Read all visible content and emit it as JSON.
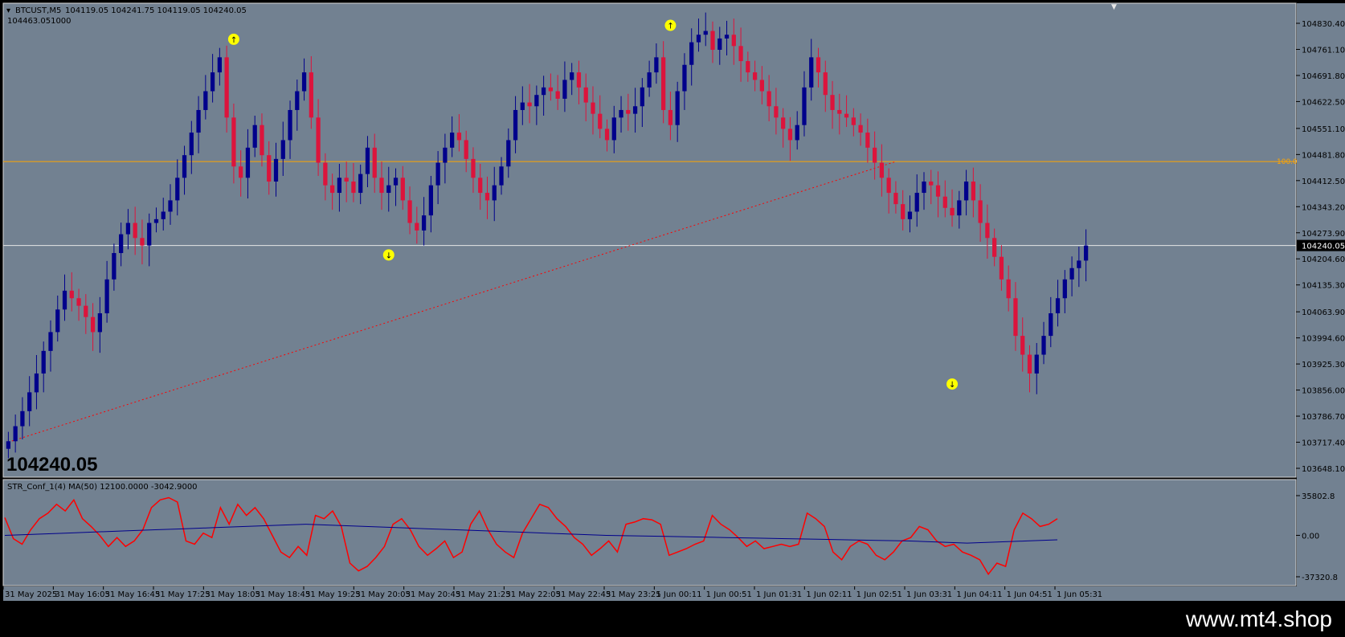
{
  "window": {
    "symbol_label": "BTCUST,M5",
    "ohlc_label": "104119.05 104241.75 104119.05 104240.05",
    "sub_value_label": "104463.051000",
    "big_price": "104240.05",
    "watermark": "www.mt4.shop"
  },
  "colors": {
    "background": "#728191",
    "bull": "#00008b",
    "bear": "#dc143c",
    "hline_orange": "#ffa500",
    "hline_white": "#e6e6e6",
    "trendline": "#ff0000",
    "arrow": "#ffff00",
    "indicator_red": "#ff0000",
    "indicator_ma": "#00008b"
  },
  "chart_data": [
    {
      "type": "candlestick",
      "title": "BTCUST,M5",
      "price_axis_labels": [
        "104830.40",
        "104761.10",
        "104691.80",
        "104622.50",
        "104551.10",
        "104481.80",
        "104412.50",
        "104343.20",
        "104273.90",
        "104204.60",
        "104135.30",
        "104063.90",
        "103994.60",
        "103925.30",
        "103856.00",
        "103786.70",
        "103717.40",
        "103648.10"
      ],
      "ylim": [
        103648.1,
        104830.4
      ],
      "current_price_label": "104240.05",
      "horizontal_lines": [
        {
          "price": 104463.05,
          "label": "100.0",
          "color": "orange"
        },
        {
          "price": 104240.05,
          "label": "",
          "color": "white"
        }
      ],
      "trendline": {
        "from_price": 103717.4,
        "to_price": 104463.05,
        "style": "dotted"
      },
      "time_labels": [
        "31 May 2025",
        "31 May 16:05",
        "31 May 16:45",
        "31 May 17:25",
        "31 May 18:05",
        "31 May 18:45",
        "31 May 19:25",
        "31 May 20:05",
        "31 May 20:45",
        "31 May 21:25",
        "31 May 22:05",
        "31 May 22:45",
        "31 May 23:25",
        "1 Jun 00:11",
        "1 Jun 00:51",
        "1 Jun 01:31",
        "1 Jun 02:11",
        "1 Jun 02:51",
        "1 Jun 03:31",
        "1 Jun 04:11",
        "1 Jun 04:51",
        "1 Jun 05:31"
      ],
      "fractals": [
        {
          "label": "up",
          "price": 104788
        },
        {
          "label": "down",
          "price": 104215
        },
        {
          "label": "up",
          "price": 104825
        },
        {
          "label": "down",
          "price": 103872
        }
      ],
      "candles_close_path": [
        103720,
        103760,
        103800,
        103850,
        103900,
        103960,
        104010,
        104070,
        104120,
        104100,
        104080,
        104050,
        104010,
        104060,
        104150,
        104220,
        104270,
        104300,
        104260,
        104240,
        104300,
        104310,
        104330,
        104360,
        104420,
        104480,
        104540,
        104600,
        104650,
        104700,
        104740,
        104580,
        104450,
        104420,
        104500,
        104560,
        104480,
        104410,
        104470,
        104520,
        104600,
        104650,
        104700,
        104580,
        104460,
        104400,
        104380,
        104420,
        104410,
        104380,
        104430,
        104500,
        104420,
        104380,
        104400,
        104420,
        104360,
        104300,
        104280,
        104320,
        104400,
        104460,
        104500,
        104540,
        104520,
        104470,
        104420,
        104380,
        104360,
        104400,
        104450,
        104520,
        104600,
        104620,
        104610,
        104640,
        104660,
        104650,
        104630,
        104680,
        104700,
        104660,
        104620,
        104590,
        104550,
        104520,
        104580,
        104600,
        104590,
        104610,
        104660,
        104700,
        104740,
        104600,
        104560,
        104650,
        104720,
        104780,
        104800,
        104810,
        104760,
        104790,
        104800,
        104770,
        104730,
        104700,
        104680,
        104650,
        104610,
        104580,
        104550,
        104520,
        104560,
        104660,
        104740,
        104700,
        104640,
        104600,
        104590,
        104580,
        104560,
        104540,
        104500,
        104460,
        104420,
        104380,
        104350,
        104310,
        104330,
        104380,
        104410,
        104400,
        104370,
        104340,
        104320,
        104360,
        104410,
        104360,
        104300,
        104260,
        104210,
        104150,
        104100,
        104000,
        103950,
        103900,
        103950,
        104000,
        104060,
        104100,
        104150,
        104180,
        104200,
        104240
      ]
    },
    {
      "type": "line",
      "title": "STR_Conf_1(4) MA(50) 12100.0000 -3042.9000",
      "yaxis_labels": [
        "35802.8",
        "0.00",
        "-37320.8"
      ],
      "ylim": [
        -37320.8,
        35802.8
      ],
      "series": [
        {
          "name": "STR_Conf_1(4)",
          "values": [
            16000,
            -3000,
            -8000,
            5000,
            15000,
            20000,
            28000,
            22000,
            32000,
            15000,
            8000,
            0,
            -10000,
            -2000,
            -10000,
            -5000,
            5000,
            25000,
            32000,
            34000,
            30000,
            -5000,
            -8000,
            2000,
            -2000,
            25000,
            10000,
            28000,
            18000,
            25000,
            15000,
            0,
            -15000,
            -20000,
            -10000,
            -18000,
            18000,
            15000,
            22000,
            8000,
            -25000,
            -32000,
            -28000,
            -20000,
            -10000,
            10000,
            15000,
            5000,
            -10000,
            -18000,
            -12000,
            -5000,
            -20000,
            -15000,
            10000,
            22000,
            5000,
            -8000,
            -15000,
            -20000,
            2000,
            15000,
            28000,
            25000,
            15000,
            8000,
            -2000,
            -8000,
            -18000,
            -12000,
            -5000,
            -15000,
            10000,
            12000,
            15000,
            14000,
            10000,
            -18000,
            -15000,
            -12000,
            -8000,
            -5000,
            18000,
            10000,
            5000,
            -2000,
            -10000,
            -5000,
            -12000,
            -10000,
            -8000,
            -10000,
            -8000,
            20000,
            15000,
            8000,
            -15000,
            -22000,
            -10000,
            -5000,
            -8000,
            -18000,
            -22000,
            -15000,
            -5000,
            -2000,
            8000,
            5000,
            -5000,
            -10000,
            -8000,
            -15000,
            -18000,
            -22000,
            -35000,
            -25000,
            -28000,
            5000,
            20000,
            15000,
            8000,
            10000,
            15000
          ],
          "color": "red"
        },
        {
          "name": "MA(50)",
          "values": [
            0,
            1000,
            2000,
            3000,
            4000,
            5000,
            6000,
            7000,
            8000,
            9000,
            10000,
            9000,
            8000,
            7000,
            6000,
            5000,
            4000,
            3000,
            2000,
            1000,
            0,
            -500,
            -1000,
            -1500,
            -2000,
            -2500,
            -3000,
            -3500,
            -4000,
            -4500,
            -5000,
            -6000,
            -7000,
            -6000,
            -5000,
            -4000
          ],
          "color": "navy"
        }
      ]
    }
  ]
}
